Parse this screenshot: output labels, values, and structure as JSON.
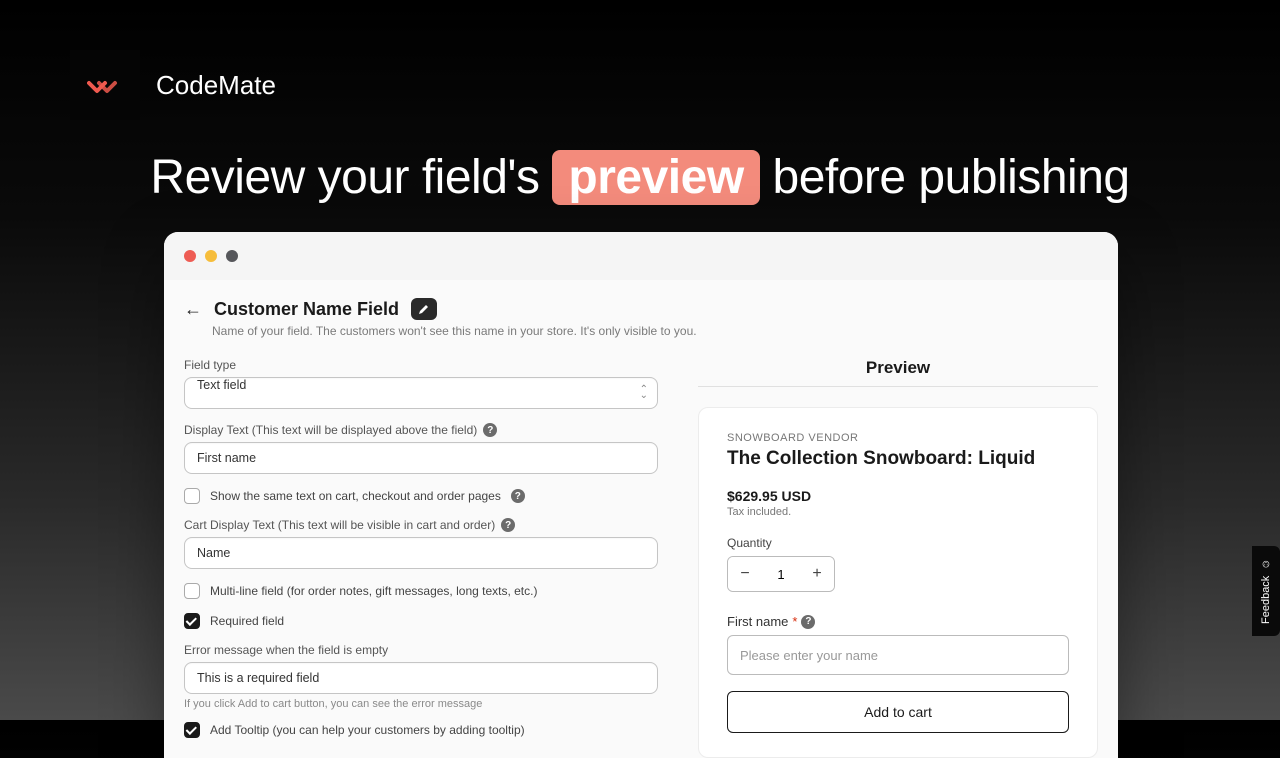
{
  "brand": {
    "name": "CodeMate"
  },
  "headline": {
    "pre": "Review your field's ",
    "highlight": "preview",
    "post": " before publishing"
  },
  "page": {
    "title": "Customer Name Field",
    "subtitle": "Name of your field. The customers won't see this name in your store. It's only visible to you."
  },
  "form": {
    "field_type_label": "Field type",
    "field_type_value": "Text field",
    "display_text_label": "Display Text (This text will be displayed above the field)",
    "display_text_value": "First name",
    "same_text_label": "Show the same text on cart, checkout and order pages",
    "cart_display_label": "Cart Display Text (This text will be visible in cart and order)",
    "cart_display_value": "Name",
    "multiline_label": "Multi-line field (for order notes, gift messages, long texts, etc.)",
    "required_label": "Required field",
    "error_msg_label": "Error message when the field is empty",
    "error_msg_value": "This is a required field",
    "error_helper": "If you click Add to cart button, you can see the error message",
    "tooltip_label": "Add Tooltip (you can help your customers by adding tooltip)"
  },
  "preview": {
    "heading": "Preview",
    "vendor": "SNOWBOARD VENDOR",
    "product_title": "The Collection Snowboard: Liquid",
    "price": "$629.95 USD",
    "tax": "Tax included.",
    "qty_label": "Quantity",
    "qty_value": "1",
    "field_label": "First name",
    "placeholder": "Please enter your name",
    "add_to_cart": "Add to cart"
  },
  "feedback": {
    "label": "Feedback"
  }
}
